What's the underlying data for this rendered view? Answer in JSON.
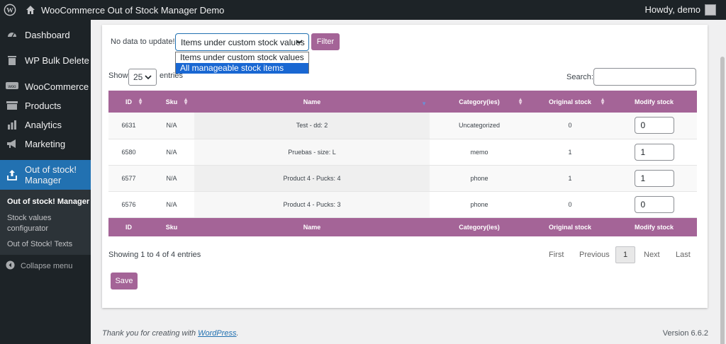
{
  "adminbar": {
    "site_name": "WooCommerce Out of Stock Manager Demo",
    "howdy": "Howdy, demo"
  },
  "sidebar": {
    "items": [
      {
        "label": "Dashboard",
        "icon": "dashboard-icon"
      },
      {
        "label": "WP Bulk Delete",
        "icon": "trash-icon"
      },
      {
        "label": "WooCommerce",
        "icon": "woocommerce-icon"
      },
      {
        "label": "Products",
        "icon": "archive-icon"
      },
      {
        "label": "Analytics",
        "icon": "bar-chart-icon"
      },
      {
        "label": "Marketing",
        "icon": "megaphone-icon"
      },
      {
        "label": "Out of stock!\nManager",
        "label_line1": "Out of stock!",
        "label_line2": "Manager",
        "icon": "upload-icon"
      }
    ],
    "submenu": [
      {
        "label": "Out of stock! Manager"
      },
      {
        "label_line1": "Stock values",
        "label_line2": "configurator"
      },
      {
        "label": "Out of Stock! Texts"
      }
    ],
    "collapse": "Collapse menu"
  },
  "filter": {
    "label": "No data to update!",
    "selected": "Items under custom stock values",
    "options": [
      "Items under custom stock values",
      "All manageable stock items"
    ],
    "highlighted_option": "All manageable stock items",
    "button": "Filter"
  },
  "length": {
    "show": "Show",
    "value": "25",
    "entries": "entries"
  },
  "search": {
    "label": "Search:",
    "value": ""
  },
  "table": {
    "columns": [
      "ID",
      "Sku",
      "Name",
      "Category(ies)",
      "Original stock",
      "Modify stock"
    ],
    "rows": [
      {
        "id": "6631",
        "sku": "N/A",
        "name": "Test - dd: 2",
        "category": "Uncategorized",
        "original": "0",
        "modify": "0"
      },
      {
        "id": "6580",
        "sku": "N/A",
        "name": "Pruebas - size: L",
        "category": "memo",
        "original": "1",
        "modify": "1"
      },
      {
        "id": "6577",
        "sku": "N/A",
        "name": "Product 4 - Pucks: 4",
        "category": "phone",
        "original": "1",
        "modify": "1"
      },
      {
        "id": "6576",
        "sku": "N/A",
        "name": "Product 4 - Pucks: 3",
        "category": "phone",
        "original": "0",
        "modify": "0"
      }
    ]
  },
  "info": "Showing 1 to 4 of 4 entries",
  "pagination": {
    "first": "First",
    "previous": "Previous",
    "current": "1",
    "next": "Next",
    "last": "Last"
  },
  "save": "Save",
  "footer": {
    "thanks_prefix": "Thank you for creating with ",
    "thanks_link": "WordPress",
    "thanks_suffix": ".",
    "version": "Version 6.6.2"
  },
  "colors": {
    "accent": "#a46497",
    "admin_dark": "#1d2327",
    "wp_blue": "#2271b1"
  }
}
